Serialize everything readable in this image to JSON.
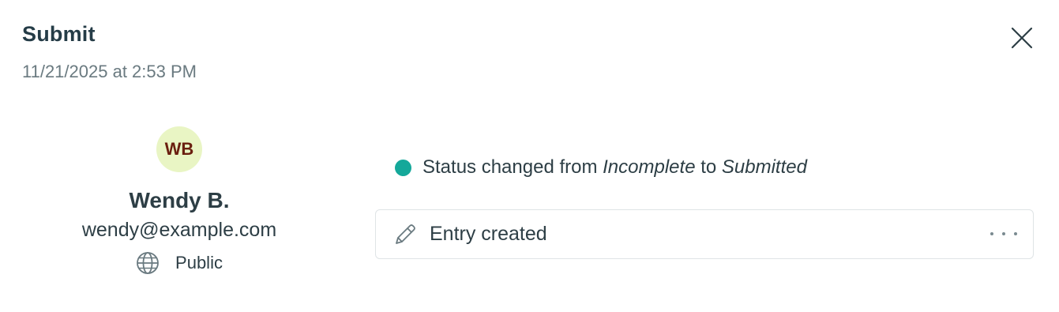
{
  "header": {
    "title": "Submit",
    "timestamp": "11/21/2025 at 2:53 PM",
    "close_icon": "close-icon"
  },
  "user": {
    "initials": "WB",
    "name": "Wendy B.",
    "email": "wendy@example.com",
    "visibility_label": "Public",
    "visibility_icon": "globe-icon",
    "avatar_bg": "#e9f5c4",
    "avatar_fg": "#6a1f0f"
  },
  "activity": {
    "status": {
      "prefix": "Status changed from",
      "from": "Incomplete",
      "connector": "to",
      "to": "Submitted",
      "dot_color": "#14a89a"
    },
    "entry": {
      "label": "Entry created",
      "icon": "pencil-icon",
      "menu_icon": "more-options-icon"
    }
  }
}
